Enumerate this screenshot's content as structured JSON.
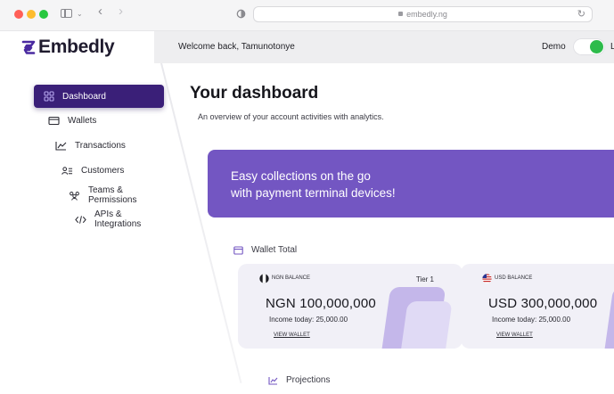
{
  "browser": {
    "url": "embedly.ng"
  },
  "brand": {
    "name": "Embedly",
    "color": "#4a2aa0"
  },
  "topbar": {
    "welcome": "Welcome back, Tamunotonye",
    "demo_label": "Demo",
    "live_label": "L",
    "demo_mode_on": true
  },
  "sidebar": {
    "items": [
      {
        "label": "Dashboard",
        "icon": "dashboard-grid-icon",
        "active": true
      },
      {
        "label": "Wallets",
        "icon": "wallet-icon",
        "active": false
      },
      {
        "label": "Transactions",
        "icon": "chart-line-icon",
        "active": false
      },
      {
        "label": "Customers",
        "icon": "customers-icon",
        "active": false
      },
      {
        "label": "Teams & Permissions",
        "icon": "team-icon",
        "active": false
      },
      {
        "label": "APIs & Integrations",
        "icon": "code-icon",
        "active": false
      }
    ]
  },
  "main": {
    "title": "Your dashboard",
    "subtitle": "An overview of your account activities with analytics.",
    "banner": {
      "text": "Easy collections on the go\n with payment terminal devices!",
      "color": "#7356c2"
    },
    "wallet_total_label": "Wallet Total",
    "projections_label": "Projections",
    "cards": [
      {
        "balance_label": "NGN BALANCE",
        "tier": "Tier 1",
        "amount": "NGN 100,000,000",
        "income": "Income today:  25,000.00",
        "view_link": "VIEW WALLET",
        "flag_icon": "ng-flag-icon"
      },
      {
        "balance_label": "USD BALANCE",
        "amount": "USD 300,000,000",
        "income": "Income today:  25,000.00",
        "view_link": "VIEW WALLET",
        "flag_icon": "us-flag-icon"
      }
    ]
  }
}
